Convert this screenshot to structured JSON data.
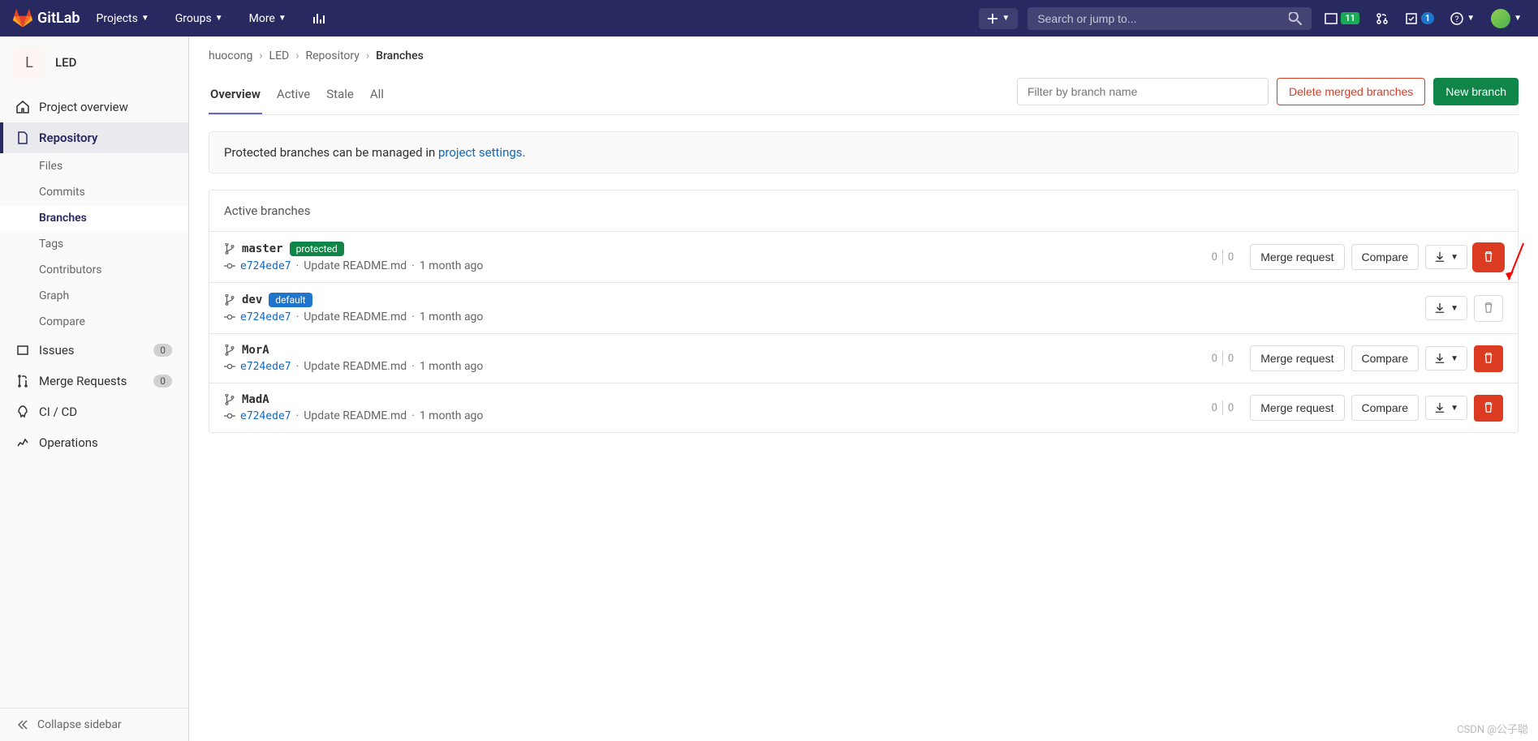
{
  "brand": "GitLab",
  "nav": {
    "projects": "Projects",
    "groups": "Groups",
    "more": "More",
    "search_placeholder": "Search or jump to..."
  },
  "nav_badges": {
    "issues": "11",
    "todos": "1"
  },
  "project": {
    "initial": "L",
    "name": "LED"
  },
  "sidebar": {
    "overview": "Project overview",
    "repository": "Repository",
    "sub": {
      "files": "Files",
      "commits": "Commits",
      "branches": "Branches",
      "tags": "Tags",
      "contributors": "Contributors",
      "graph": "Graph",
      "compare": "Compare"
    },
    "issues": "Issues",
    "issues_count": "0",
    "merge_requests": "Merge Requests",
    "mr_count": "0",
    "cicd": "CI / CD",
    "operations": "Operations",
    "collapse": "Collapse sidebar"
  },
  "breadcrumb": {
    "a": "huocong",
    "b": "LED",
    "c": "Repository",
    "d": "Branches"
  },
  "tabs": {
    "overview": "Overview",
    "active": "Active",
    "stale": "Stale",
    "all": "All"
  },
  "controls": {
    "filter_placeholder": "Filter by branch name",
    "delete_merged": "Delete merged branches",
    "new_branch": "New branch"
  },
  "banner": {
    "text": "Protected branches can be managed in ",
    "link": "project settings",
    "dot": "."
  },
  "panel_title": "Active branches",
  "labels": {
    "protected": "protected",
    "default": "default",
    "merge_request": "Merge request",
    "compare": "Compare"
  },
  "branches": [
    {
      "name": "master",
      "badge": "protected",
      "sha": "e724ede7",
      "msg": "Update README.md",
      "time": "1 month ago",
      "behind": "0",
      "ahead": "0",
      "mr": true,
      "compare": true,
      "delete_highlight": true,
      "delete_disabled": false
    },
    {
      "name": "dev",
      "badge": "default",
      "sha": "e724ede7",
      "msg": "Update README.md",
      "time": "1 month ago",
      "behind": "",
      "ahead": "",
      "mr": false,
      "compare": false,
      "delete_highlight": false,
      "delete_disabled": true
    },
    {
      "name": "MorA",
      "badge": "",
      "sha": "e724ede7",
      "msg": "Update README.md",
      "time": "1 month ago",
      "behind": "0",
      "ahead": "0",
      "mr": true,
      "compare": true,
      "delete_highlight": false,
      "delete_disabled": false
    },
    {
      "name": "MadA",
      "badge": "",
      "sha": "e724ede7",
      "msg": "Update README.md",
      "time": "1 month ago",
      "behind": "0",
      "ahead": "0",
      "mr": true,
      "compare": true,
      "delete_highlight": false,
      "delete_disabled": false
    }
  ],
  "watermark": "CSDN @公子聪"
}
